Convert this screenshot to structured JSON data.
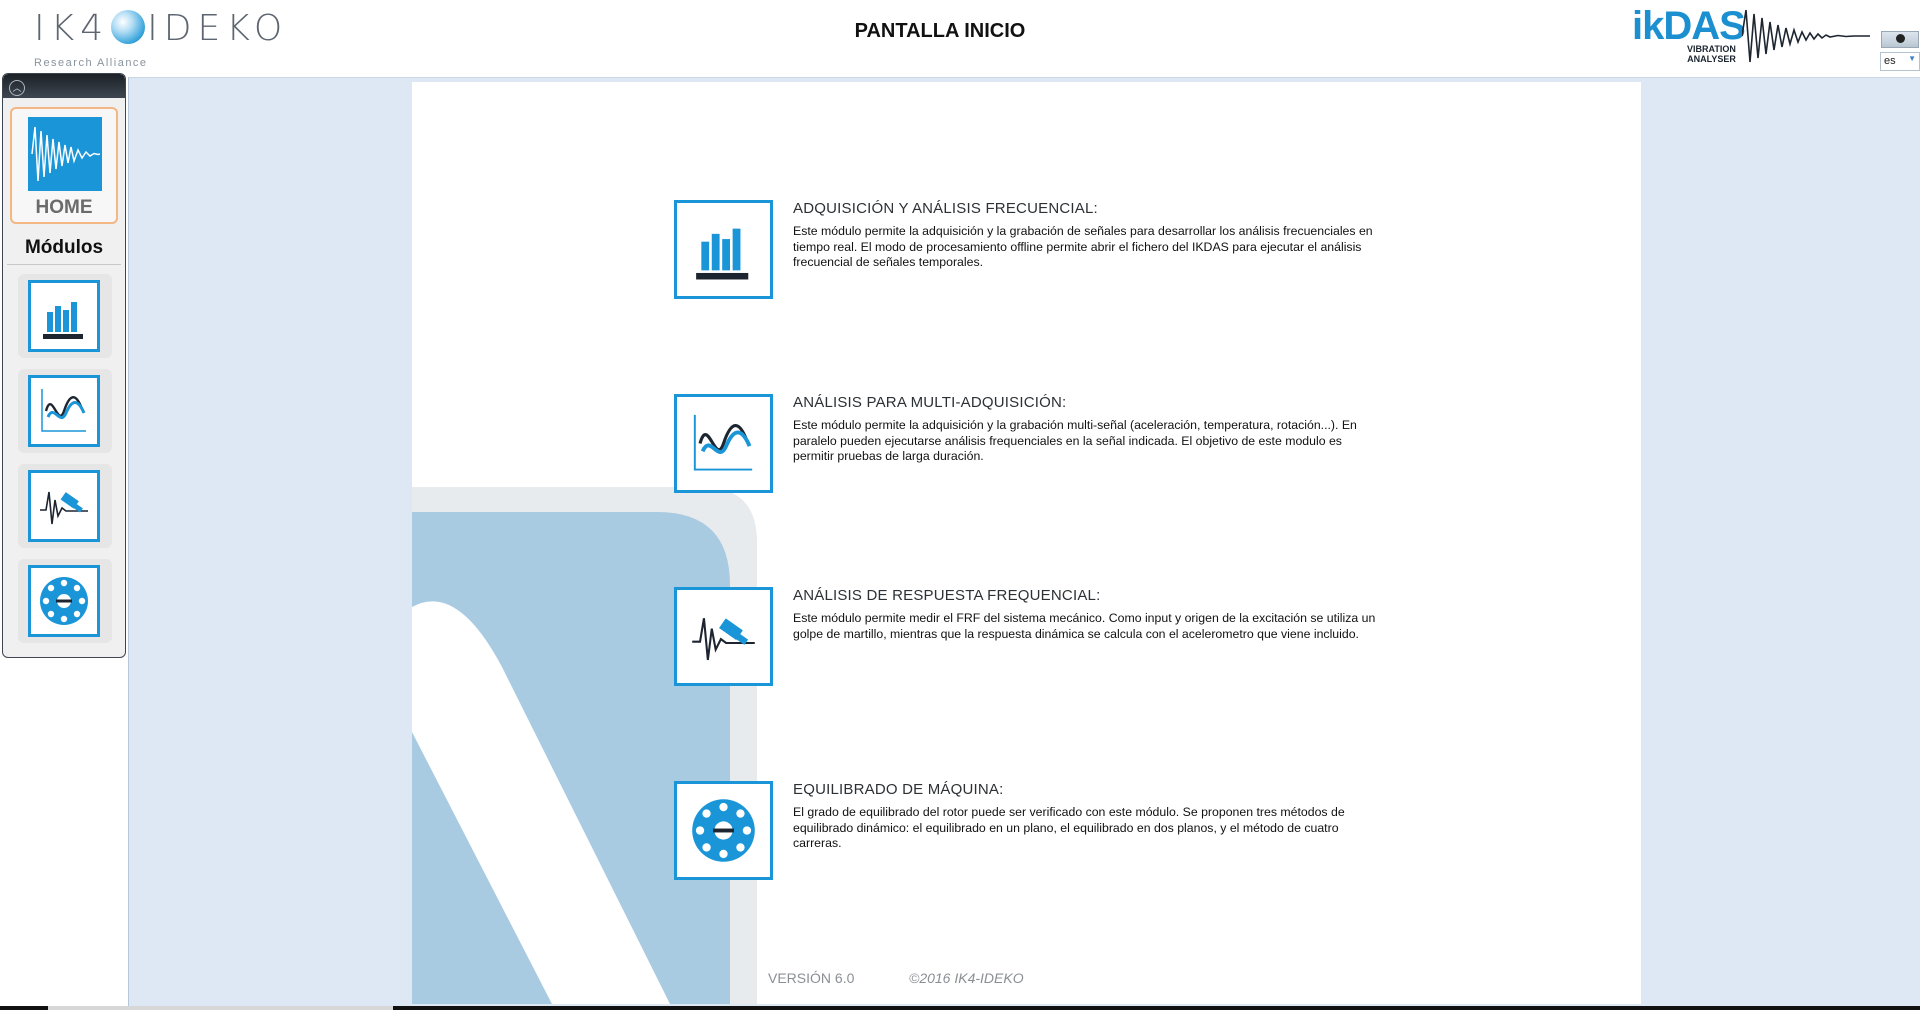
{
  "header": {
    "brand_left": "IK4",
    "brand_right": "IDEKO",
    "brand_tagline": "Research Alliance",
    "page_title": "PANTALLA INICIO",
    "ikdas_name": "ikDAS",
    "ikdas_sub_line1": "VIBRATION",
    "ikdas_sub_line2": "ANALYSER",
    "language": "es"
  },
  "sidebar": {
    "home_label": "HOME",
    "modules_title": "Módulos",
    "items": [
      {
        "icon": "bar-chart-icon"
      },
      {
        "icon": "multi-signal-icon"
      },
      {
        "icon": "hammer-impact-icon"
      },
      {
        "icon": "rotor-balance-icon"
      }
    ]
  },
  "modules": [
    {
      "title": "ADQUISICIÓN Y ANÁLISIS FRECUENCIAL:",
      "description": "Este módulo permite la adquisición y la grabación de señales para desarrollar los análisis frecuenciales en tiempo real. El modo de procesamiento offline permite abrir el fichero del IKDAS para ejecutar el análisis frecuencial de señales temporales."
    },
    {
      "title": "ANÁLISIS PARA MULTI-ADQUISICIÓN:",
      "description": "Este módulo permite la adquisición y la grabación multi-señal (aceleración, temperatura, rotación...). En paralelo pueden ejecutarse análisis frequenciales en la señal indicada. El objetivo de este modulo es permitir pruebas de larga duración."
    },
    {
      "title": "ANÁLISIS DE RESPUESTA FREQUENCIAL:",
      "description": "Este módulo permite medir el FRF del sistema mecánico. Como input y origen de la excitación se utiliza un golpe de martillo, mientras que la respuesta dinámica se calcula con el acelerometro que viene incluido."
    },
    {
      "title": "EQUILIBRADO DE MÁQUINA:",
      "description": "El grado de equilibrado del rotor puede ser verificado con este módulo. Se proponen tres métodos de equilibrado dinámico: el equilibrado en un plano, el equilibrado en dos planos, y el método de cuatro carreras."
    }
  ],
  "footer": {
    "version": "VERSIÓN 6.0",
    "copyright": "©2016 IK4-IDEKO"
  },
  "colors": {
    "accent": "#1a95d8",
    "main_bg": "#dde8f4",
    "home_border": "#f3b784"
  }
}
